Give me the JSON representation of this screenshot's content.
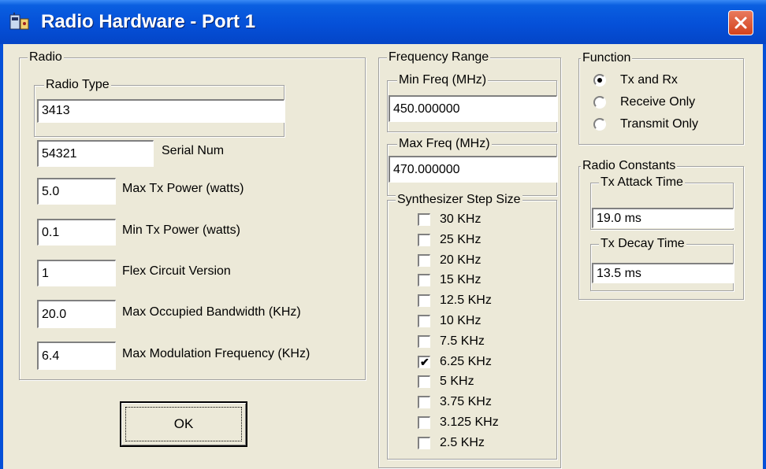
{
  "window": {
    "title": "Radio Hardware - Port  1",
    "accent": "#0550d8",
    "close_icon": "close-icon"
  },
  "radio": {
    "legend": "Radio",
    "radio_type_legend": "Radio Type",
    "radio_type_value": "3413",
    "fields": [
      {
        "label": "Serial Num",
        "value": "54321"
      },
      {
        "label": "Max Tx Power (watts)",
        "value": "5.0"
      },
      {
        "label": "Min Tx Power (watts)",
        "value": "0.1"
      },
      {
        "label": "Flex Circuit Version",
        "value": "1"
      },
      {
        "label": "Max Occupied Bandwidth (KHz)",
        "value": "20.0"
      },
      {
        "label": "Max Modulation Frequency (KHz)",
        "value": "6.4"
      }
    ]
  },
  "frequency": {
    "legend": "Frequency Range",
    "min_legend": "Min Freq (MHz)",
    "min_value": "450.000000",
    "max_legend": "Max Freq (MHz)",
    "max_value": "470.000000"
  },
  "synth": {
    "legend": "Synthesizer Step Size",
    "steps": [
      {
        "label": "30 KHz",
        "checked": false
      },
      {
        "label": "25 KHz",
        "checked": false
      },
      {
        "label": "20 KHz",
        "checked": false
      },
      {
        "label": "15 KHz",
        "checked": false
      },
      {
        "label": "12.5 KHz",
        "checked": false
      },
      {
        "label": "10 KHz",
        "checked": false
      },
      {
        "label": "7.5 KHz",
        "checked": false
      },
      {
        "label": "6.25 KHz",
        "checked": true
      },
      {
        "label": "5 KHz",
        "checked": false
      },
      {
        "label": "3.75 KHz",
        "checked": false
      },
      {
        "label": "3.125 KHz",
        "checked": false
      },
      {
        "label": "2.5 KHz",
        "checked": false
      }
    ]
  },
  "function": {
    "legend": "Function",
    "options": [
      {
        "label": "Tx and Rx",
        "selected": true
      },
      {
        "label": "Receive Only",
        "selected": false
      },
      {
        "label": "Transmit Only",
        "selected": false
      }
    ]
  },
  "constants": {
    "legend": "Radio Constants",
    "attack_legend": "Tx Attack Time",
    "attack_value": "19.0 ms",
    "decay_legend": "Tx Decay Time",
    "decay_value": "13.5 ms"
  },
  "ok_label": "OK"
}
